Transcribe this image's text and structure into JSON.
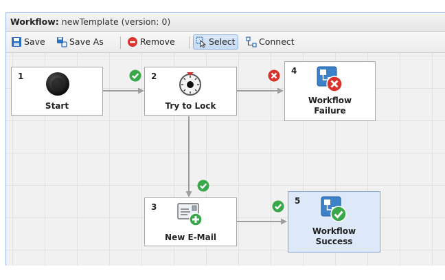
{
  "window": {
    "title_bold": "Workflow:",
    "title_rest": " newTemplate (version: 0)"
  },
  "toolbar": {
    "save_label": "Save",
    "save_as_label": "Save As",
    "remove_label": "Remove",
    "select_label": "Select",
    "connect_label": "Connect"
  },
  "nodes": [
    {
      "id": "1",
      "label": "Start",
      "icon": "start-circle-icon"
    },
    {
      "id": "2",
      "label": "Try to Lock",
      "icon": "lock-dial-icon"
    },
    {
      "id": "3",
      "label": "New E-Mail",
      "icon": "new-email-icon"
    },
    {
      "id": "4",
      "label_line1": "Workflow",
      "label_line2": "Failure",
      "icon": "workflow-failure-icon"
    },
    {
      "id": "5",
      "label_line1": "Workflow",
      "label_line2": "Success",
      "icon": "workflow-success-icon",
      "selected": true
    }
  ],
  "colors": {
    "success": "#3aa74a",
    "failure": "#d9322b",
    "accent": "#2c6fbf",
    "connector": "#9e9e9e"
  }
}
